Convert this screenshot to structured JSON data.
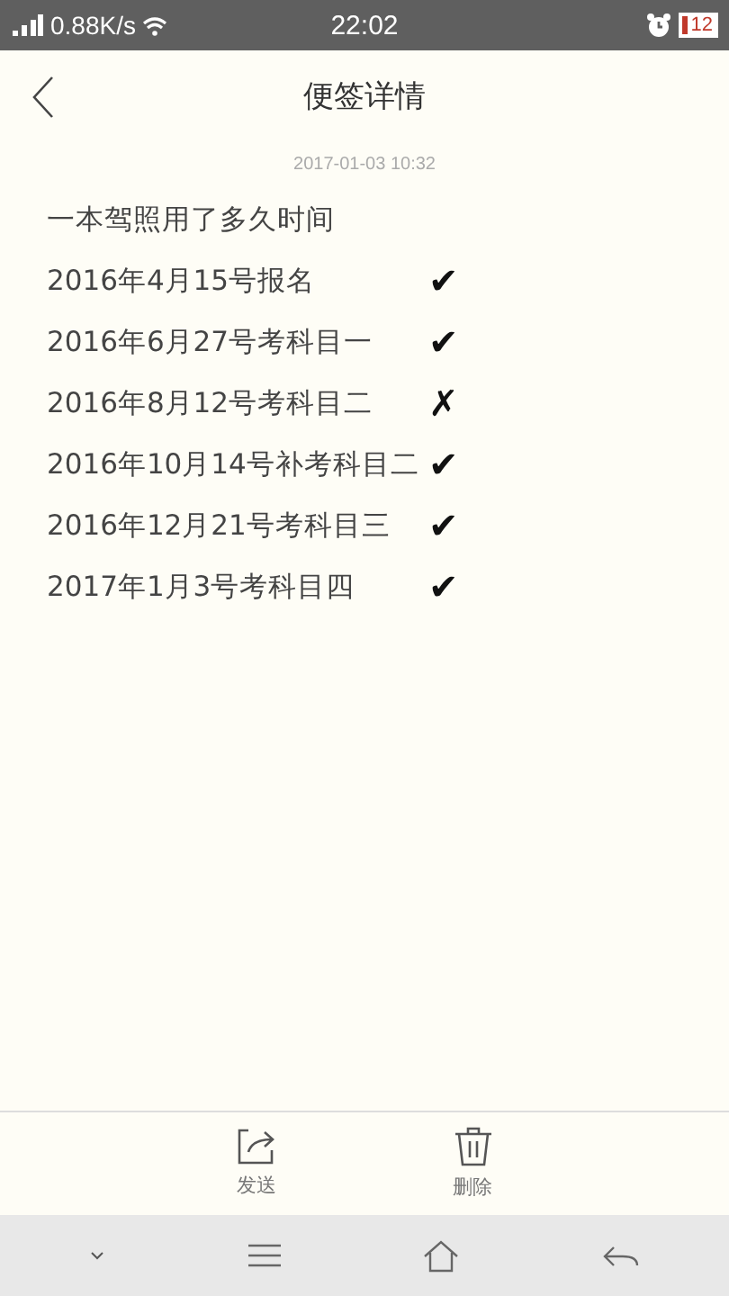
{
  "status_bar": {
    "speed": "0.88K/s",
    "time": "22:02",
    "battery": "12"
  },
  "header": {
    "title": "便签详情"
  },
  "note": {
    "date": "2017-01-03 10:32",
    "title": "一本驾照用了多久时间",
    "lines": [
      {
        "text": "2016年4月15号报名",
        "mark": "✔"
      },
      {
        "text": "2016年6月27号考科目一",
        "mark": "✔"
      },
      {
        "text": "2016年8月12号考科目二",
        "mark": "✗"
      },
      {
        "text": "2016年10月14号补考科目二",
        "mark": "✔"
      },
      {
        "text": "2016年12月21号考科目三",
        "mark": "✔"
      },
      {
        "text": "2017年1月3号考科目四",
        "mark": "✔"
      }
    ]
  },
  "toolbar": [
    {
      "kind": "send",
      "label": "发送"
    },
    {
      "kind": "delete",
      "label": "删除"
    }
  ]
}
